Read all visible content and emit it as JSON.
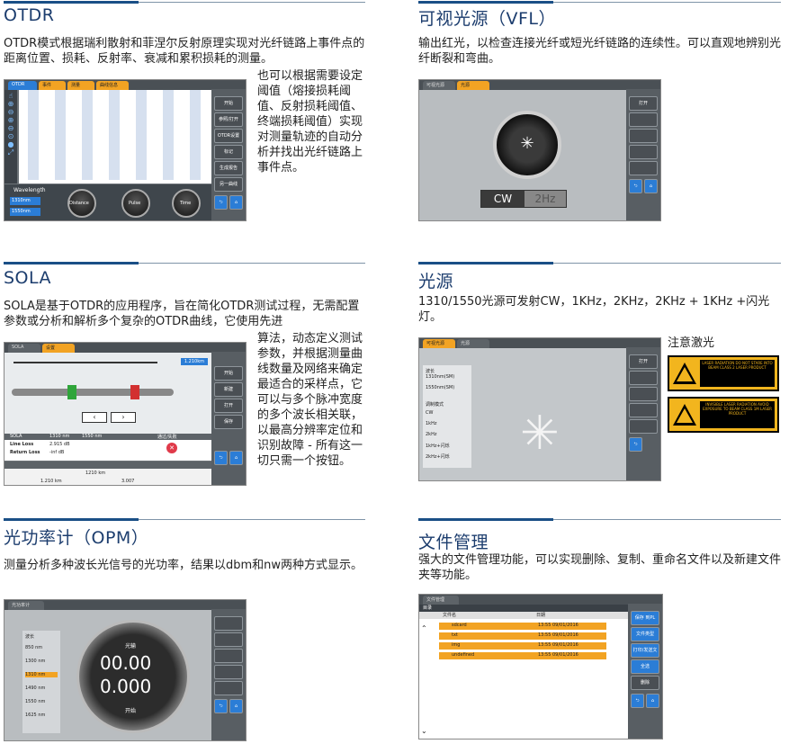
{
  "otdr": {
    "title": "OTDR",
    "desc": "OTDR模式根据瑞利散射和菲涅尔反射原理实现对光纤链路上事件点的距离位置、损耗、反射率、衰减和累积损耗的测量。",
    "desc2": "也可以根据需要设定阈值（熔接损耗阈值、反射损耗阈值、终端损耗阈值）实现对测量轨迹的自动分析并找出光纤链路上事件点。",
    "screen": {
      "tabs": [
        "OTDR",
        "事件",
        "测量",
        "曲线信息"
      ],
      "side_buttons": [
        "开始",
        "参照/打开",
        "OTDR设置",
        "标记",
        "生成报告",
        "另一曲线"
      ],
      "battery": "100%",
      "wavelength_label": "Wavelength",
      "wavelength_options": [
        "1310nm",
        "1550nm"
      ],
      "knobs": [
        {
          "label": "Distance",
          "mode": "AUTO"
        },
        {
          "label": "Pulse",
          "mode": "AUTO"
        },
        {
          "label": "Time",
          "mode": "AUTO"
        }
      ]
    }
  },
  "vfl": {
    "title": "可视光源（VFL）",
    "desc": "输出红光，以检查连接光纤或短光纤链路的连续性。可以直观地辨别光纤断裂和弯曲。",
    "screen": {
      "tabs": [
        "可视光源",
        "光源"
      ],
      "side_buttons": [
        "打开"
      ],
      "modes": [
        "CW",
        "2Hz"
      ]
    }
  },
  "sola": {
    "title": "SOLA",
    "desc": "SOLA是基于OTDR的应用程序，旨在简化OTDR测试过程，无需配置参数或分析和解析多个复杂的OTDR曲线，它使用先进",
    "desc2": "算法，动态定义测试参数，并根据测量曲线数量及网络来确定最适合的采样点，它可以与多个脉冲宽度的多个波长相关联，以最高分辨率定位和识别故障 - 所有这一切只需一个按钮。",
    "screen": {
      "tabs": [
        "SOLA",
        "设置"
      ],
      "side_buttons": [
        "开始",
        "新建",
        "打开",
        "保存"
      ],
      "distance": "1.210km",
      "table_head": [
        "SOLA",
        "1310 nm",
        "1550 nm"
      ],
      "table_rows": [
        [
          "Line Loss",
          "2.915 dB",
          "-"
        ],
        [
          "Return Loss",
          "-inf dB",
          "-"
        ]
      ],
      "pass_label": "通过/失败",
      "bottom_head": [
        "",
        "距离",
        "距离(m)",
        "1310 nm",
        "1550 nm",
        "1550 nm"
      ],
      "bottom_rows": [
        [
          "",
          "",
          "1210 km",
          "1310 nm",
          "1550 nm",
          "1550 nm"
        ],
        [
          "",
          "1.210 km",
          "",
          "3.007",
          "-",
          "-"
        ]
      ]
    }
  },
  "light_source": {
    "title": "光源",
    "desc": "1310/1550光源可发射CW，1KHz，2KHz，2KHz + 1KHz +闪光灯。",
    "warning_title": "注意激光",
    "screen": {
      "tabs": [
        "可视光源",
        "光源"
      ],
      "side_buttons": [
        "打开"
      ],
      "wavelength_label": "波长",
      "wavelengths": [
        "1310nm(SM)",
        "1550nm(SM)"
      ],
      "freq_label": "调制模式",
      "freqs": [
        "CW",
        "1kHz",
        "2kHz",
        "1kHz+闪烁",
        "2kHz+闪烁"
      ]
    },
    "label1": "LASER RADIATION DO NOT STARE INTO BEAM CLASS 2 LASER PRODUCT",
    "label2": "INVISIBLE LASER RADIATION AVOID EXPOSURE TO BEAM CLASS 1M LASER PRODUCT"
  },
  "opm": {
    "title": "光功率计（OPM）",
    "desc": "测量分析多种波长光信号的光功率，结果以dbm和nw两种方式显示。",
    "screen": {
      "tabs": [
        "光功率计"
      ],
      "wavelength_label": "波长",
      "wavelengths": [
        "850 nm",
        "1300 nm",
        "1310 nm",
        "1490 nm",
        "1550 nm",
        "1625 nm"
      ],
      "reading1": "00.00",
      "reading2": "0.000",
      "top_label": "光输",
      "bottom_label": "开始"
    }
  },
  "files": {
    "title": "文件管理",
    "desc": "强大的文件管理功能，可以实现删除、复制、重命名文件以及新建文件夹等功能。",
    "screen": {
      "tabs": [
        "文件管理"
      ],
      "path": "目录",
      "col_name": "文件名",
      "col_date": "日期",
      "side_buttons": [
        "保存\n到PL",
        "文件类型",
        "打印/发送文件",
        "全选",
        "删除"
      ],
      "rows": [
        {
          "name": "sdcard",
          "date": "13:55 09/01/2016"
        },
        {
          "name": "txt",
          "date": "13:55 09/01/2016"
        },
        {
          "name": "img",
          "date": "13:55 09/01/2016"
        },
        {
          "name": "undefined",
          "date": "13:55 09/01/2016"
        }
      ]
    }
  },
  "colors": {
    "heading": "#1c3d6e",
    "rule": "#1a4f86",
    "accent_blue": "#2b7dd6",
    "orange": "#f2a323"
  }
}
